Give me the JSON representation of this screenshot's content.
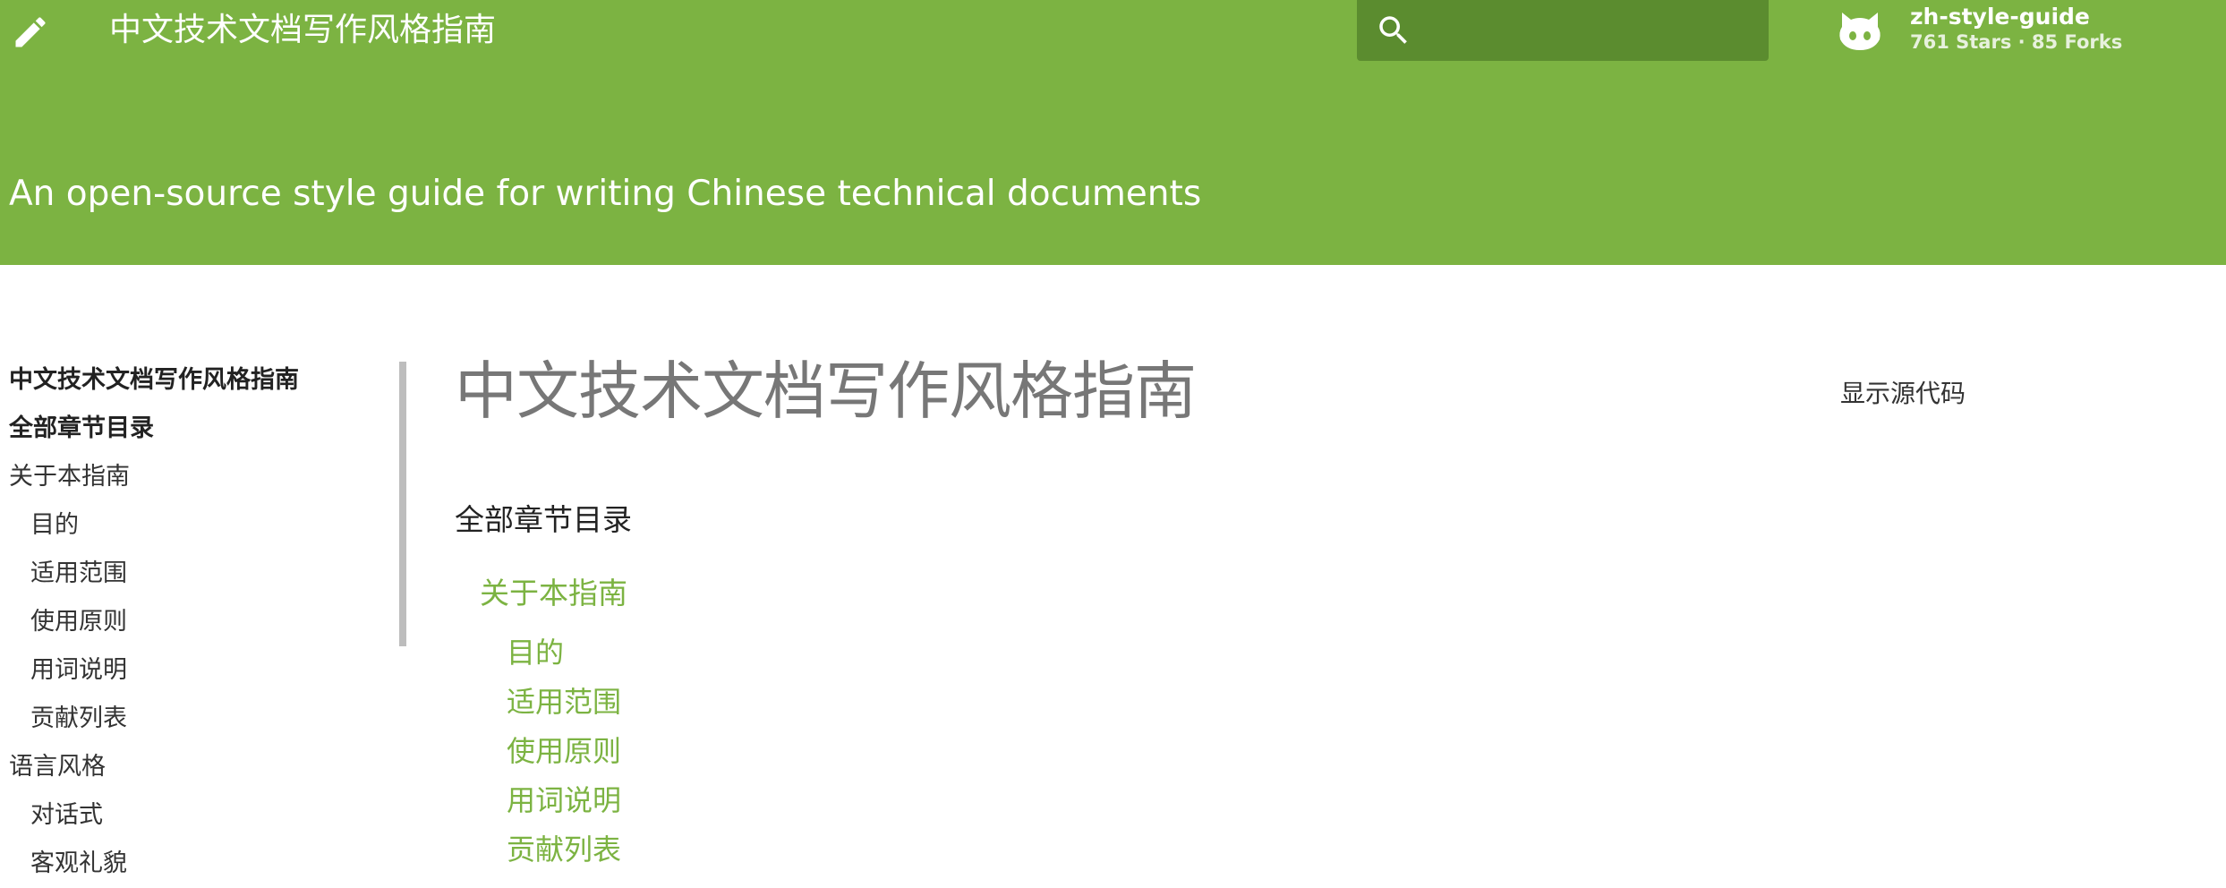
{
  "header": {
    "title": "中文技术文档写作风格指南",
    "tagline": "An open-source style guide for writing Chinese technical documents",
    "search": {
      "placeholder": ""
    },
    "repo": {
      "name": "zh-style-guide",
      "stats": "761 Stars · 85 Forks"
    }
  },
  "sidebar": {
    "items": [
      {
        "label": "中文技术文档写作风格指南",
        "level": 0,
        "bold": true
      },
      {
        "label": "全部章节目录",
        "level": 0,
        "bold": true
      },
      {
        "label": "关于本指南",
        "level": 0,
        "bold": false
      },
      {
        "label": "目的",
        "level": 1,
        "bold": false
      },
      {
        "label": "适用范围",
        "level": 1,
        "bold": false
      },
      {
        "label": "使用原则",
        "level": 1,
        "bold": false
      },
      {
        "label": "用词说明",
        "level": 1,
        "bold": false
      },
      {
        "label": "贡献列表",
        "level": 1,
        "bold": false
      },
      {
        "label": "语言风格",
        "level": 0,
        "bold": false
      },
      {
        "label": "对话式",
        "level": 1,
        "bold": false
      },
      {
        "label": "客观礼貌",
        "level": 1,
        "bold": false
      }
    ]
  },
  "main": {
    "title": "中文技术文档写作风格指南",
    "toc_heading": "全部章节目录",
    "toc": [
      {
        "label": "关于本指南",
        "level": 1
      },
      {
        "label": "目的",
        "level": 2
      },
      {
        "label": "适用范围",
        "level": 2
      },
      {
        "label": "使用原则",
        "level": 2
      },
      {
        "label": "用词说明",
        "level": 2
      },
      {
        "label": "贡献列表",
        "level": 2
      }
    ],
    "source_link": "显示源代码"
  },
  "colors": {
    "header_bg": "#7cb342",
    "search_bg": "#5b8c2f",
    "link": "#7cb342"
  },
  "icons": [
    "pencil-icon",
    "search-icon",
    "github-icon"
  ]
}
